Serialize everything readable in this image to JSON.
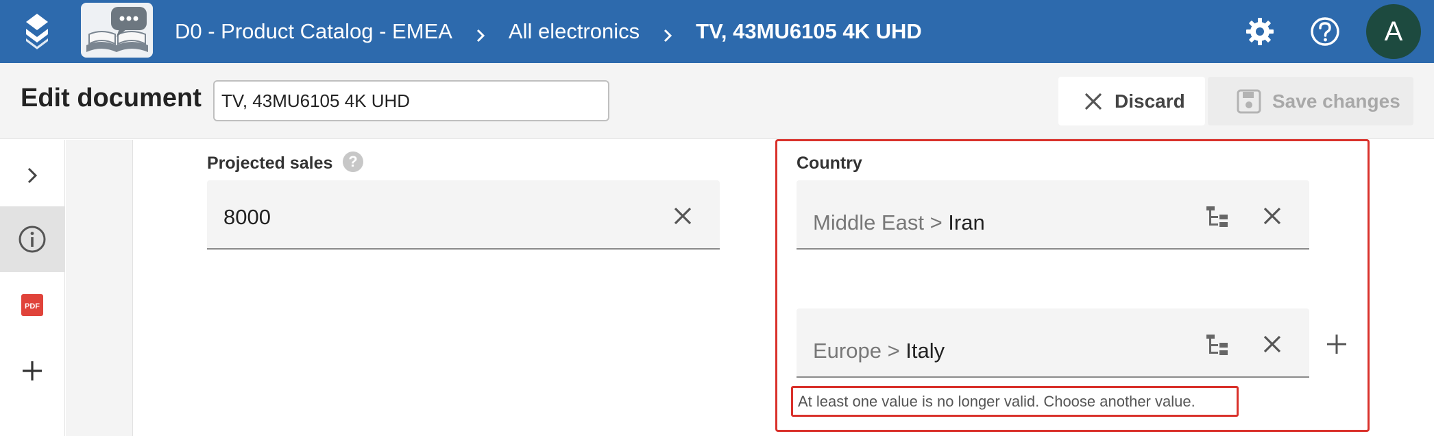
{
  "header": {
    "breadcrumbs": [
      "D0 - Product Catalog - EMEA",
      "All electronics",
      "TV, 43MU6105 4K UHD"
    ],
    "avatar_initial": "A",
    "brand_color": "#2d6aad"
  },
  "toolbar": {
    "title": "Edit document",
    "document_name": "TV, 43MU6105 4K UHD",
    "discard_label": "Discard",
    "save_label": "Save changes"
  },
  "sidebar": {
    "items": [
      {
        "icon": "chevron-right-icon"
      },
      {
        "icon": "info-icon",
        "active": true
      },
      {
        "icon": "pdf-icon",
        "text": "PDF"
      },
      {
        "icon": "plus-icon"
      }
    ]
  },
  "fields": {
    "projected_sales": {
      "label": "Projected sales",
      "help": "?",
      "value": "8000"
    },
    "country": {
      "label": "Country",
      "values": [
        {
          "prefix": "Middle East > ",
          "name": "Iran"
        },
        {
          "prefix": "Europe > ",
          "name": "Italy"
        }
      ],
      "error": "At least one value is no longer valid. Choose another value.",
      "error_color": "#d9312b"
    }
  }
}
